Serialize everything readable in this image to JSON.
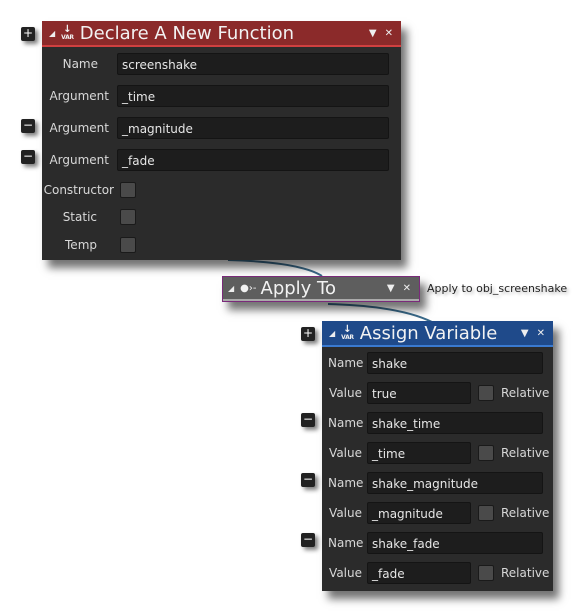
{
  "declare_function": {
    "title": "Declare A New Function",
    "icon": "var-icon",
    "header_color": "#8b2a2a",
    "rows": [
      {
        "label": "Name",
        "value": "screenshake"
      },
      {
        "label": "Argument",
        "value": "_time"
      },
      {
        "label": "Argument",
        "value": "_magnitude"
      },
      {
        "label": "Argument",
        "value": "_fade"
      }
    ],
    "checkboxes": [
      {
        "label": "Constructor",
        "checked": false
      },
      {
        "label": "Static",
        "checked": false
      },
      {
        "label": "Temp",
        "checked": false
      }
    ],
    "add_button": "+",
    "remove_button": "−"
  },
  "apply_to": {
    "title": "Apply To",
    "icon": "apply-icon",
    "side_label": "Apply to obj_screenshake",
    "header_color": "#5e5e5e"
  },
  "assign_variable": {
    "title": "Assign Variable",
    "icon": "var-icon",
    "header_color": "#1f4a8a",
    "name_label": "Name",
    "value_label": "Value",
    "relative_label": "Relative",
    "entries": [
      {
        "name": "shake",
        "value": "true",
        "relative": false
      },
      {
        "name": "shake_time",
        "value": "_time",
        "relative": false
      },
      {
        "name": "shake_magnitude",
        "value": "_magnitude",
        "relative": false
      },
      {
        "name": "shake_fade",
        "value": "_fade",
        "relative": false
      }
    ]
  },
  "icons": {
    "collapse": "◢",
    "dropdown": "▼",
    "close": "✕",
    "arrow": "↓",
    "var_text": "VAR",
    "apply_glyph": "●›-"
  }
}
